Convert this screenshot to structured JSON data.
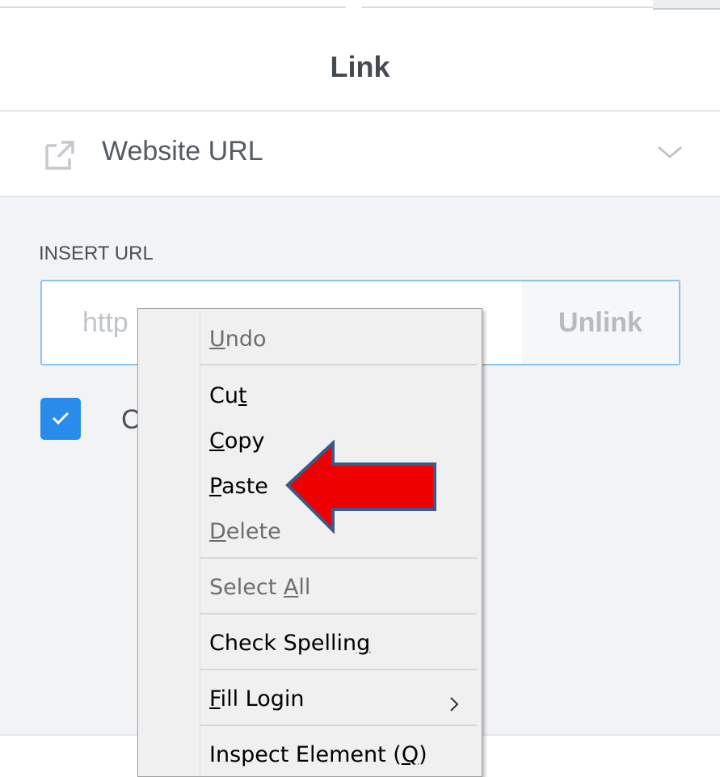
{
  "dialog": {
    "title": "Link",
    "link_type": "Website URL",
    "insert_label": "INSERT URL",
    "url_placeholder": "http",
    "unlink_label": "Unlink",
    "checkbox_label": "C",
    "checkbox_checked": true
  },
  "context_menu": {
    "items": {
      "undo": {
        "u": "U",
        "rest": "ndo",
        "enabled": true
      },
      "cut": {
        "pre": "Cu",
        "u": "t",
        "rest": "",
        "enabled": true
      },
      "copy": {
        "u": "C",
        "rest": "opy",
        "enabled": true
      },
      "paste": {
        "u": "P",
        "rest": "aste",
        "enabled": true
      },
      "delete": {
        "u": "D",
        "rest": "elete",
        "enabled": false
      },
      "select_all": {
        "pre": "Select ",
        "u": "A",
        "rest": "ll",
        "enabled": false
      },
      "check_spelling": {
        "pre": "Check Spellin",
        "u": "g",
        "rest": "",
        "enabled": true
      },
      "fill_login": {
        "u": "F",
        "rest": "ill Login",
        "enabled": true,
        "has_submenu": true
      },
      "inspect": {
        "pre": "Inspect Element (",
        "u": "Q",
        "rest": ")",
        "enabled": true
      }
    },
    "submenu_glyph": ">"
  },
  "annotation": {
    "arrow_color": "#ee0000",
    "arrow_border": "#3a5a8a",
    "points_to": "paste"
  },
  "colors": {
    "accent": "#2a8cea",
    "panel_bg": "#f2f3f5",
    "input_border": "#8ac3ee"
  },
  "icons": {
    "link_type": "external-link-icon",
    "dropdown": "chevron-down-icon",
    "checkbox": "check-icon",
    "submenu": "chevron-right-icon"
  }
}
